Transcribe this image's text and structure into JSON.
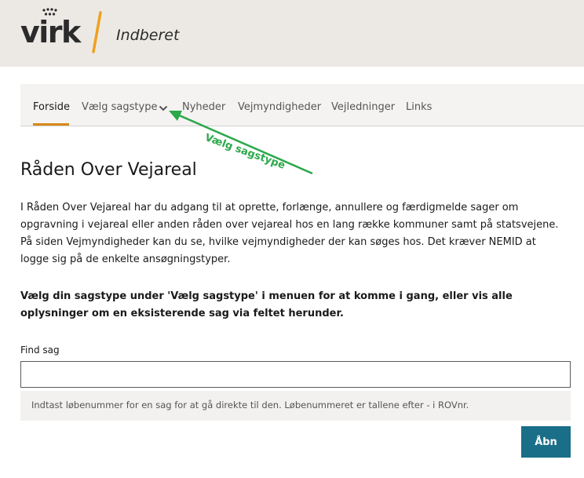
{
  "header": {
    "logo_text": "virk",
    "app_name": "Indberet",
    "brand_accent": "#f0a01e"
  },
  "nav": {
    "items": [
      {
        "label": "Forside",
        "active": true
      },
      {
        "label": "Vælg sagstype",
        "active": false,
        "has_dropdown": true
      },
      {
        "label": "Nyheder",
        "active": false
      },
      {
        "label": "Vejmyndigheder",
        "active": false
      },
      {
        "label": "Vejledninger",
        "active": false
      },
      {
        "label": "Links",
        "active": false
      }
    ],
    "underline_color": "#d88a18"
  },
  "annotation": {
    "label": "Vælg sagstype",
    "color": "#2aa84a"
  },
  "main": {
    "title": "Råden Over Vejareal",
    "intro": "I Råden Over Vejareal har du adgang til at oprette, forlænge, annullere og færdigmelde sager om opgravning i vejareal eller anden råden over vejareal hos en lang række kommuner samt på statsvejene. På siden Vejmyndigheder kan du se, hvilke vejmyndigheder der kan søges hos. Det kræver NEMID at logge sig på de enkelte ansøgningstyper.",
    "instruction": "Vælg din sagstype under 'Vælg sagstype' i menuen for at komme i gang, eller vis alle oplysninger om en eksisterende sag via feltet herunder."
  },
  "find_case": {
    "label": "Find sag",
    "value": "",
    "help": "Indtast løbenummer for en sag for at gå direkte til den. Løbenummeret er tallene efter - i ROVnr.",
    "button_label": "Åbn",
    "button_color": "#1a6e88"
  }
}
